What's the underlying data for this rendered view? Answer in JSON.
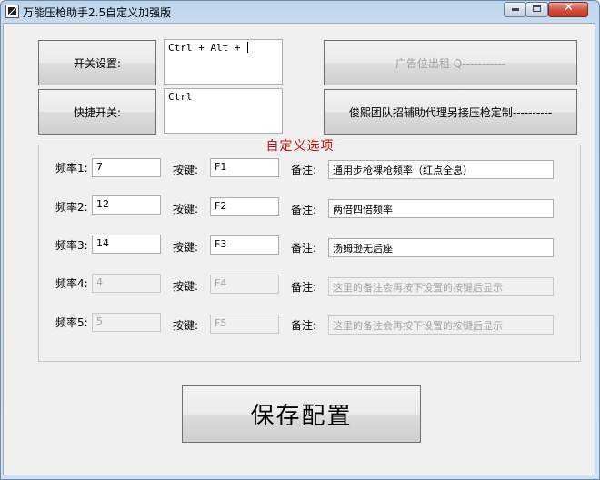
{
  "window": {
    "title": "万能压枪助手2.5自定义加强版",
    "controls": {
      "minimize": "minimize-icon",
      "maximize": "maximize-icon",
      "close": "close-icon"
    }
  },
  "hotkey_section": {
    "toggle_label": "开关设置:",
    "toggle_value": "Ctrl + Alt + ",
    "quick_label": "快捷开关:",
    "quick_value": "Ctrl"
  },
  "ads": {
    "ad_button": "广告位出租 Q-----------",
    "team_button": "俊熙团队招辅助代理另接压枪定制----------"
  },
  "custom_options": {
    "title": "自定义选项",
    "freq_prefix": "频率",
    "key_label": "按键:",
    "note_label": "备注:",
    "rows": [
      {
        "freq_label": "频率1:",
        "freq": "7",
        "key": "F1",
        "note": "通用步枪裸枪频率（红点全息）",
        "enabled": true
      },
      {
        "freq_label": "频率2:",
        "freq": "12",
        "key": "F2",
        "note": "两倍四倍频率",
        "enabled": true
      },
      {
        "freq_label": "频率3:",
        "freq": "14",
        "key": "F3",
        "note": "汤姆逊无后座",
        "enabled": true
      },
      {
        "freq_label": "频率4:",
        "freq": "4",
        "key": "F4",
        "note": "这里的备注会再按下设置的按键后显示",
        "enabled": false
      },
      {
        "freq_label": "频率5:",
        "freq": "5",
        "key": "F5",
        "note": "这里的备注会再按下设置的按键后显示",
        "enabled": false
      }
    ]
  },
  "save_button": "保存配置",
  "colors": {
    "group_title": "#cc1010",
    "disabled_text": "#a3a3a3",
    "dialog_bg": "#f0f0f0"
  }
}
